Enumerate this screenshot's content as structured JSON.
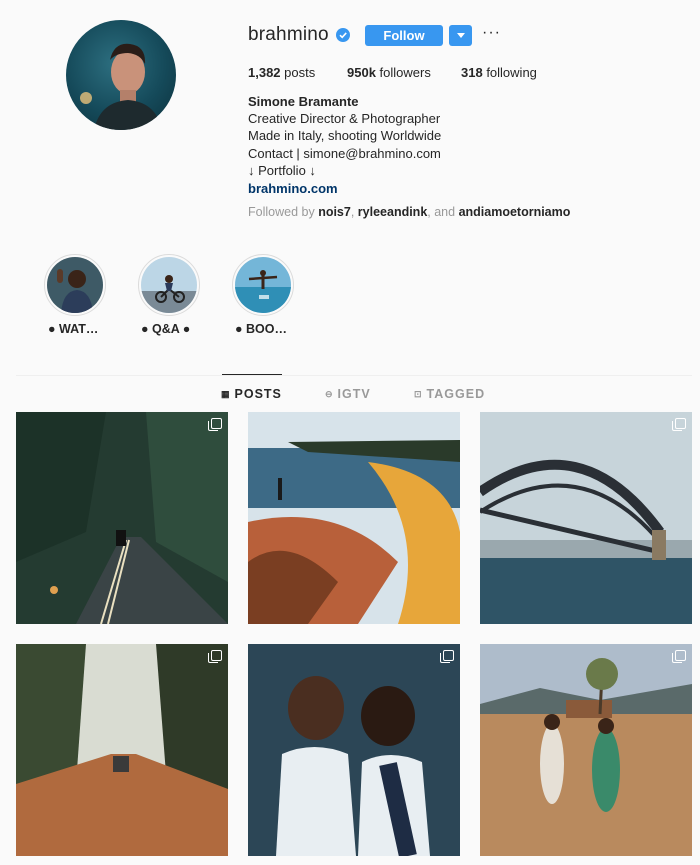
{
  "profile": {
    "username": "brahmino",
    "follow_label": "Follow",
    "more_label": "···",
    "stats": {
      "posts_count": "1,382",
      "posts_label": " posts",
      "followers_count": "950k",
      "followers_label": " followers",
      "following_count": "318",
      "following_label": " following"
    },
    "bio": {
      "name": "Simone Bramante",
      "line1": "Creative Director & Photographer",
      "line2": "Made in Italy, shooting Worldwide",
      "line3": "Contact | simone@brahmino.com",
      "line4": "↓ Portfolio ↓",
      "link": "brahmino.com"
    },
    "followed_by": {
      "prefix": "Followed by ",
      "user1": "nois7",
      "sep1": ", ",
      "user2": "ryleeandink",
      "sep2": ", and ",
      "user3": "andiamoetorniamo"
    }
  },
  "highlights": [
    {
      "label": "● WAT… "
    },
    {
      "label": "● Q&A ●"
    },
    {
      "label": "● BOO…"
    }
  ],
  "tabs": [
    {
      "label": "POSTS",
      "icon": "grid-icon",
      "active": true
    },
    {
      "label": "IGTV",
      "icon": "igtv-icon",
      "active": false
    },
    {
      "label": "TAGGED",
      "icon": "tagged-icon",
      "active": false
    }
  ],
  "colors": {
    "accent": "#3897f0",
    "text": "#262626",
    "muted": "#999999",
    "link": "#003569"
  }
}
